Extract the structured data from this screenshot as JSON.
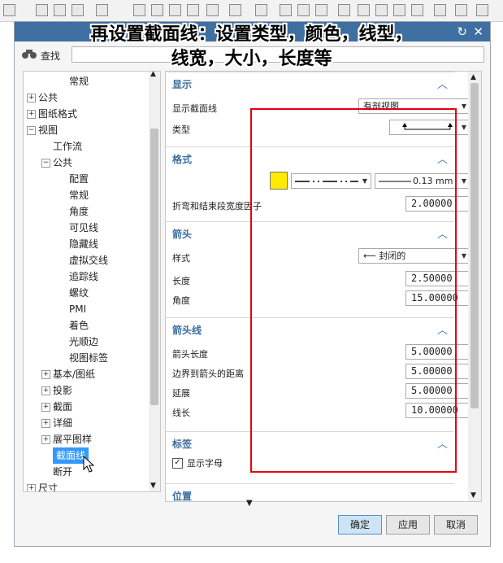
{
  "overlay": {
    "line1": "再设置截面线：设置类型，颜色，线型，",
    "line2": "线宽，大小，长度等"
  },
  "colors": {
    "accent": "#3d6d9e",
    "title_bar": "#3f6fa0",
    "selected": "#3399ff",
    "annotation_box": "#e60012",
    "swatch": "#ffea00"
  },
  "search": {
    "label": "查找",
    "icon": "binoculars-icon",
    "value": ""
  },
  "tree": {
    "items": [
      {
        "label": "常规",
        "indent": 2
      },
      {
        "label": "公共",
        "indent": 0,
        "exp": "+"
      },
      {
        "label": "图纸格式",
        "indent": 0,
        "exp": "+"
      },
      {
        "label": "视图",
        "indent": 0,
        "exp": "−"
      },
      {
        "label": "工作流",
        "indent": 1
      },
      {
        "label": "公共",
        "indent": 1,
        "exp": "−"
      },
      {
        "label": "配置",
        "indent": 2
      },
      {
        "label": "常规",
        "indent": 2
      },
      {
        "label": "角度",
        "indent": 2
      },
      {
        "label": "可见线",
        "indent": 2
      },
      {
        "label": "隐藏线",
        "indent": 2
      },
      {
        "label": "虚拟交线",
        "indent": 2
      },
      {
        "label": "追踪线",
        "indent": 2
      },
      {
        "label": "螺纹",
        "indent": 2
      },
      {
        "label": "PMI",
        "indent": 2
      },
      {
        "label": "着色",
        "indent": 2
      },
      {
        "label": "光顺边",
        "indent": 2
      },
      {
        "label": "视图标签",
        "indent": 2
      },
      {
        "label": "基本/图纸",
        "indent": 1,
        "exp": "+"
      },
      {
        "label": "投影",
        "indent": 1,
        "exp": "+"
      },
      {
        "label": "截面",
        "indent": 1,
        "exp": "+"
      },
      {
        "label": "详细",
        "indent": 1,
        "exp": "+"
      },
      {
        "label": "展平图样",
        "indent": 1,
        "exp": "+"
      },
      {
        "label": "截面线",
        "indent": 1,
        "selected": true
      },
      {
        "label": "断开",
        "indent": 1
      },
      {
        "label": "尺寸",
        "indent": 0,
        "exp": "+"
      }
    ]
  },
  "sections": {
    "display": {
      "title": "显示",
      "show_label": "显示截面线",
      "show_value": "有剖视图",
      "type_label": "类型"
    },
    "format": {
      "title": "格式",
      "color": "#ffea00",
      "line_width": "0.13 mm",
      "factor_label": "折弯和结束段宽度因子",
      "factor_value": "2.00000"
    },
    "arrowhead": {
      "title": "箭头",
      "style_label": "样式",
      "style_value": "封闭的",
      "length_label": "长度",
      "length_value": "2.50000",
      "angle_label": "角度",
      "angle_value": "15.00000"
    },
    "arrowline": {
      "title": "箭头线",
      "arrow_length_label": "箭头长度",
      "arrow_length_value": "5.00000",
      "border_label": "边界到箭头的距离",
      "border_value": "5.00000",
      "extend_label": "延展",
      "extend_value": "5.00000",
      "line_length_label": "线长",
      "line_length_value": "10.00000"
    },
    "label": {
      "title": "标签",
      "show_letters_label": "显示字母",
      "show_letters_checked": true
    },
    "position": {
      "title": "位置"
    }
  },
  "buttons": {
    "ok": "确定",
    "apply": "应用",
    "cancel": "取消"
  }
}
